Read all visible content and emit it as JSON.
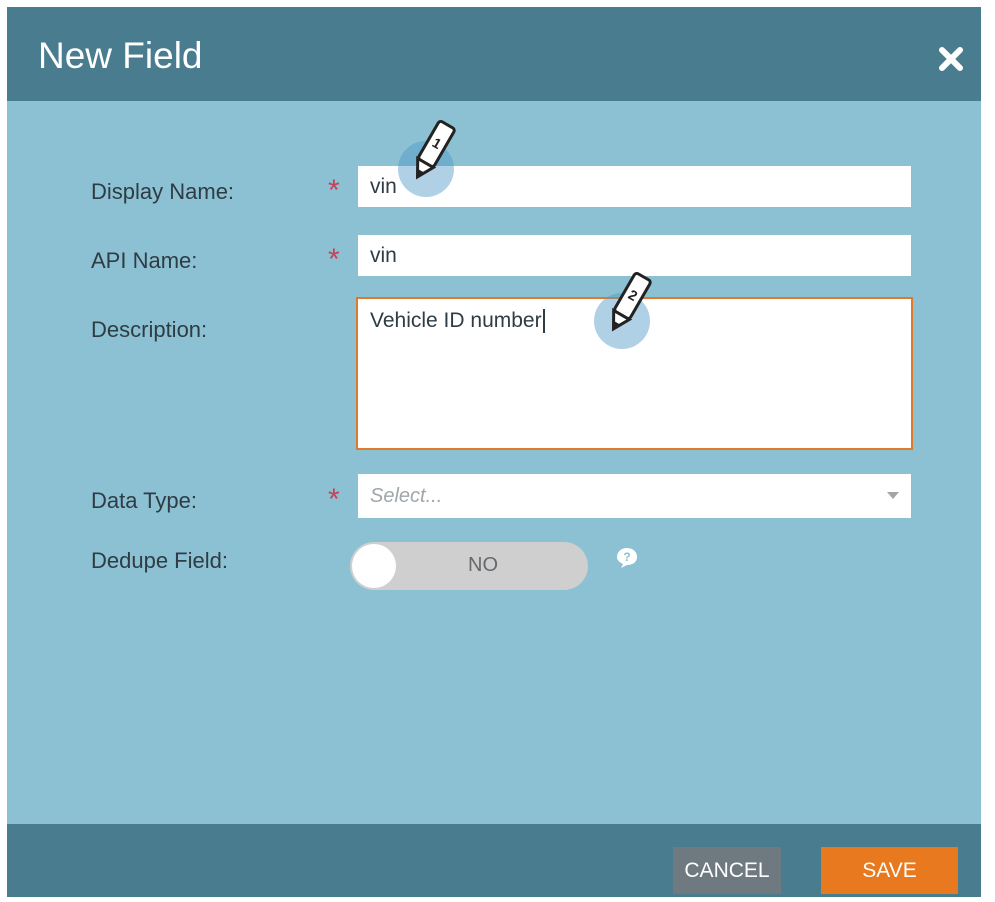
{
  "dialog": {
    "title": "New Field",
    "close_icon": "close-icon"
  },
  "form": {
    "display_name": {
      "label": "Display Name:",
      "required": "*",
      "value": "vin"
    },
    "api_name": {
      "label": "API Name:",
      "required": "*",
      "value": "vin"
    },
    "description": {
      "label": "Description:",
      "value": "Vehicle ID number"
    },
    "data_type": {
      "label": "Data Type:",
      "required": "*",
      "placeholder": "Select..."
    },
    "dedupe_field": {
      "label": "Dedupe Field:",
      "toggle_value": "NO",
      "help_icon": "help-bubble-icon"
    }
  },
  "markers": [
    {
      "number": "1",
      "icon": "pencil-icon"
    },
    {
      "number": "2",
      "icon": "pencil-icon"
    }
  ],
  "footer": {
    "cancel_label": "CANCEL",
    "save_label": "SAVE"
  },
  "colors": {
    "header": "#4a7c8f",
    "body": "#8bc1d3",
    "required": "#c4435a",
    "save": "#e8791e",
    "cancel": "#6e7a80",
    "focus_border": "#e07a2a"
  }
}
